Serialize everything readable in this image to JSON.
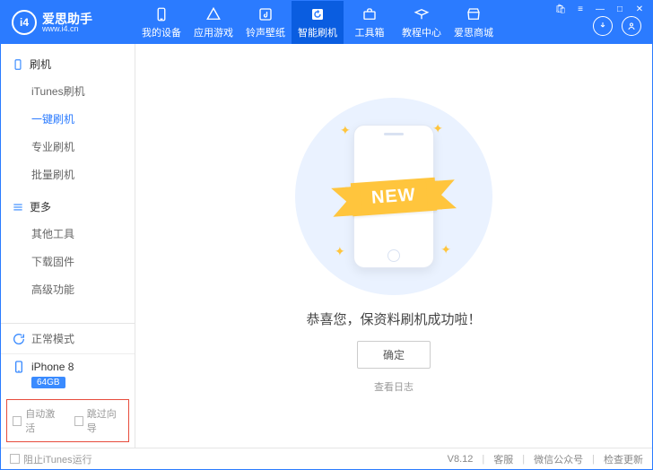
{
  "app": {
    "name": "爱思助手",
    "domain": "www.i4.cn"
  },
  "header_tabs": [
    {
      "label": "我的设备"
    },
    {
      "label": "应用游戏"
    },
    {
      "label": "铃声壁纸"
    },
    {
      "label": "智能刷机"
    },
    {
      "label": "工具箱"
    },
    {
      "label": "教程中心"
    },
    {
      "label": "爱思商城"
    }
  ],
  "sidebar": {
    "group1": "刷机",
    "items1": [
      "iTunes刷机",
      "一键刷机",
      "专业刷机",
      "批量刷机"
    ],
    "group2": "更多",
    "items2": [
      "其他工具",
      "下载固件",
      "高级功能"
    ],
    "mode": "正常模式",
    "device_name": "iPhone 8",
    "storage": "64GB"
  },
  "options": {
    "auto_activate": "自动激活",
    "skip_guide": "跳过向导"
  },
  "main": {
    "ribbon": "NEW",
    "success": "恭喜您，保资料刷机成功啦！",
    "confirm": "确定",
    "view_log": "查看日志"
  },
  "footer": {
    "block_itunes": "阻止iTunes运行",
    "version": "V8.12",
    "support": "客服",
    "wechat": "微信公众号",
    "check_update": "检查更新"
  }
}
